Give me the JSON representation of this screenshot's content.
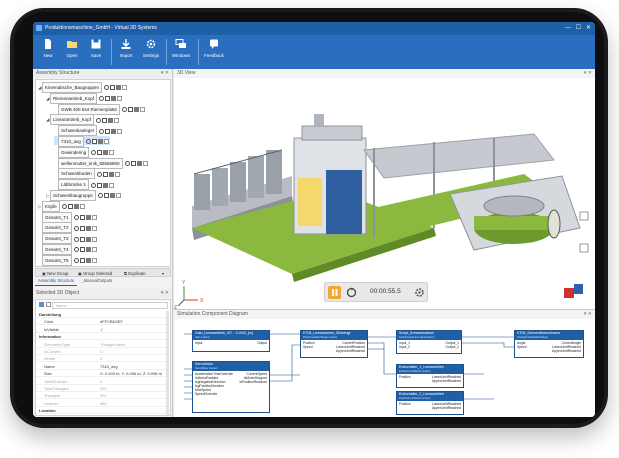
{
  "window": {
    "title": "Produktionsmaschine_GmbH - Virtual 3D Systems",
    "controls": {
      "minimize": "—",
      "maximize": "☐",
      "close": "✕"
    }
  },
  "ribbon": {
    "buttons": [
      {
        "label": "New",
        "icon": "new-file-icon"
      },
      {
        "label": "Open",
        "icon": "open-folder-icon"
      },
      {
        "label": "Save",
        "icon": "save-disk-icon"
      },
      {
        "label": "Import",
        "icon": "import-icon"
      },
      {
        "label": "Settings",
        "icon": "gear-icon"
      },
      {
        "label": "Windows",
        "icon": "windows-stack-icon"
      },
      {
        "label": "Feedback",
        "icon": "feedback-icon"
      }
    ]
  },
  "assembly": {
    "title": "Assembly Structure",
    "tree": [
      {
        "label": "Kinematische_Baugruppen",
        "indent": 0,
        "arrow": "◢"
      },
      {
        "label": "Riemenantrieb_Kopf",
        "indent": 1,
        "arrow": "◢"
      },
      {
        "label": "GWB 400 644 Riemenplatte",
        "indent": 2,
        "arrow": ""
      },
      {
        "label": "Linearantrieb_Kopf",
        "indent": 1,
        "arrow": "◢"
      },
      {
        "label": "Schwenkauleger",
        "indent": 2,
        "arrow": ""
      },
      {
        "label": "7310_avg",
        "indent": 2,
        "arrow": ""
      },
      {
        "label": "Gewindering",
        "indent": 2,
        "arrow": ""
      },
      {
        "label": "wellenmutter_knik_65556800",
        "indent": 2,
        "arrow": ""
      },
      {
        "label": "Schwenkboden",
        "indent": 2,
        "arrow": ""
      },
      {
        "label": "Läbbrücke 1",
        "indent": 2,
        "arrow": ""
      },
      {
        "label": "Schwenkbaugruppe",
        "indent": 1,
        "arrow": "▷"
      },
      {
        "label": "Köpfe",
        "indent": 0,
        "arrow": "▷"
      },
      {
        "label": "Gesamt_T1",
        "indent": 0,
        "arrow": ""
      },
      {
        "label": "Gesamt_T2",
        "indent": 0,
        "arrow": ""
      },
      {
        "label": "Gesamt_T3",
        "indent": 0,
        "arrow": ""
      },
      {
        "label": "Gesamt_T4",
        "indent": 0,
        "arrow": ""
      },
      {
        "label": "Gesamt_T5",
        "indent": 0,
        "arrow": ""
      }
    ],
    "toolbar": {
      "new_group": "New Group",
      "group_selected": "Group Selected",
      "duplicate": "Duplicate"
    },
    "tabs": [
      "Assembly Structure",
      "_ManualOutputs"
    ]
  },
  "properties": {
    "title": "Selected 3D Object",
    "search_placeholder": "Name",
    "rows": [
      {
        "key": "Darstellung",
        "value": "",
        "type": "cat"
      },
      {
        "key": "Color",
        "value": "#FFCBD2EF",
        "type": "normal"
      },
      {
        "key": "IsVisible",
        "value": "✓",
        "type": "normal"
      },
      {
        "key": "Information",
        "value": "",
        "type": "cat"
      },
      {
        "key": "GeometryType",
        "value": "Triangle Mesh",
        "type": "dim"
      },
      {
        "key": "IsConvex",
        "value": "☐",
        "type": "dim"
      },
      {
        "key": "Kinder",
        "value": "0",
        "type": "dim"
      },
      {
        "key": "Name",
        "value": "7310_avg",
        "type": "normal"
      },
      {
        "key": "Size",
        "value": "X: 0.003 m; Y: 0.096 m; Z: 0.096 m",
        "type": "normal"
      },
      {
        "key": "TotalChildren",
        "value": "0",
        "type": "dim"
      },
      {
        "key": "TotalTriangles",
        "value": "532",
        "type": "dim"
      },
      {
        "key": "Triangles",
        "value": "532",
        "type": "dim"
      },
      {
        "key": "Vertices",
        "value": "480",
        "type": "dim"
      },
      {
        "key": "Location",
        "value": "",
        "type": "cat"
      }
    ]
  },
  "view3d": {
    "title": "3D View",
    "axes": {
      "x": "X",
      "y": "Y",
      "z": "Z"
    }
  },
  "player": {
    "time": "00:00:55.5"
  },
  "sim": {
    "title": "Simulation Component Diagram",
    "blocks": [
      {
        "title": "Gain_Linearantrieb_IST - 1/1000_{m}",
        "sub": "Gain (meter)",
        "inputs": [
          "Input"
        ],
        "outputs": [
          "Output"
        ]
      },
      {
        "title": "ServoMotor",
        "sub": "ServoMotor (meter)",
        "inputs": [
          "AccelerationTimeOverride",
          "IsMotorEnabled",
          "IsgNegativeDirection",
          "IsgPositiveDirection",
          "MaxSpeed",
          "SpeedOverride"
        ],
        "outputs": [
          "CurrentSpeed",
          "IsMotorStopped",
          "IsPositionReached"
        ]
      },
      {
        "title": "KT06_Linearantrieb_Gleisengl",
        "sub": "DriveTranslatorTarget (meter)",
        "inputs": [
          "Position",
          "Speed"
        ],
        "outputs": [
          "CurrentPosition",
          "LowerLimitReached",
          "UpperLimitReached"
        ]
      },
      {
        "title": "Script_Schwenkwinkel",
        "sub": "ScriptComponent (Automation)",
        "inputs": [
          "Input_1",
          "Input_2"
        ],
        "outputs": [
          "Output_1",
          "Output_2"
        ]
      },
      {
        "title": "Endschalter_1_Linearantrieb",
        "sub": "PositionLimitSwitch (meter)",
        "inputs": [
          "Position"
        ],
        "outputs": [
          "LowerLimitReached",
          "UpperLimitReached"
        ]
      },
      {
        "title": "Endschalter_2_Linearantrieb",
        "sub": "PositionLimitSwitch (meter)",
        "inputs": [
          "Position"
        ],
        "outputs": [
          "LowerLimitReached",
          "UpperLimitReached"
        ]
      },
      {
        "title": "KT05_Schwenkbeschlosmn",
        "sub": "AnalogDriveRotationTarget",
        "inputs": [
          "Angle",
          "Speed"
        ],
        "outputs": [
          "CurrentAngle",
          "LowerLimitReached",
          "UpperLimitReached"
        ]
      }
    ]
  },
  "colors": {
    "accent": "#1f5fa8",
    "ribbon": "#2a6fbf",
    "machine_green": "#8bb93f",
    "machine_blue": "#2f5f9e"
  }
}
